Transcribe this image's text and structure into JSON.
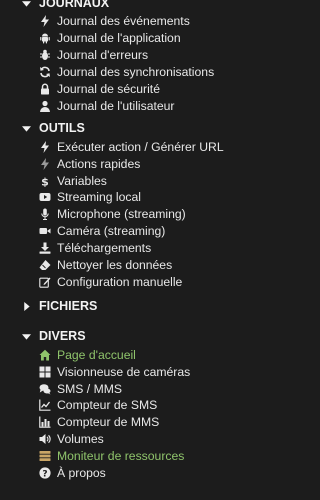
{
  "sections": {
    "journaux": {
      "title": "JOURNAUX",
      "items": [
        {
          "label": "Journal des événements",
          "icon": "bolt-icon"
        },
        {
          "label": "Journal de l'application",
          "icon": "android-icon"
        },
        {
          "label": "Journal d'erreurs",
          "icon": "bug-icon"
        },
        {
          "label": "Journal des synchronisations",
          "icon": "sync-icon"
        },
        {
          "label": "Journal de sécurité",
          "icon": "lock-icon"
        },
        {
          "label": "Journal de l'utilisateur",
          "icon": "user-icon"
        }
      ]
    },
    "outils": {
      "title": "OUTILS",
      "items": [
        {
          "label": "Exécuter action / Générer URL",
          "icon": "bolt-icon"
        },
        {
          "label": "Actions rapides",
          "icon": "bolt-icon"
        },
        {
          "label": "Variables",
          "icon": "dollar-icon"
        },
        {
          "label": "Streaming local",
          "icon": "youtube-icon"
        },
        {
          "label": "Microphone (streaming)",
          "icon": "microphone-icon"
        },
        {
          "label": "Caméra (streaming)",
          "icon": "video-camera-icon"
        },
        {
          "label": "Téléchargements",
          "icon": "download-icon"
        },
        {
          "label": "Nettoyer les données",
          "icon": "eraser-icon"
        },
        {
          "label": "Configuration manuelle",
          "icon": "edit-icon"
        }
      ]
    },
    "fichiers": {
      "title": "FICHIERS"
    },
    "divers": {
      "title": "DIVERS",
      "items": [
        {
          "label": "Page d'accueil",
          "icon": "home-icon",
          "active": true
        },
        {
          "label": "Visionneuse de caméras",
          "icon": "grid-icon"
        },
        {
          "label": "SMS / MMS",
          "icon": "chat-icon"
        },
        {
          "label": "Compteur de SMS",
          "icon": "line-chart-icon"
        },
        {
          "label": "Compteur de MMS",
          "icon": "bar-chart-icon"
        },
        {
          "label": "Volumes",
          "icon": "volume-icon"
        },
        {
          "label": "Moniteur de ressources",
          "icon": "server-icon",
          "active": true
        },
        {
          "label": "À propos",
          "icon": "question-icon"
        }
      ]
    }
  },
  "colors": {
    "background": "#1c1c1c",
    "text": "#e8e8e8",
    "active_text": "#8fc46b"
  }
}
